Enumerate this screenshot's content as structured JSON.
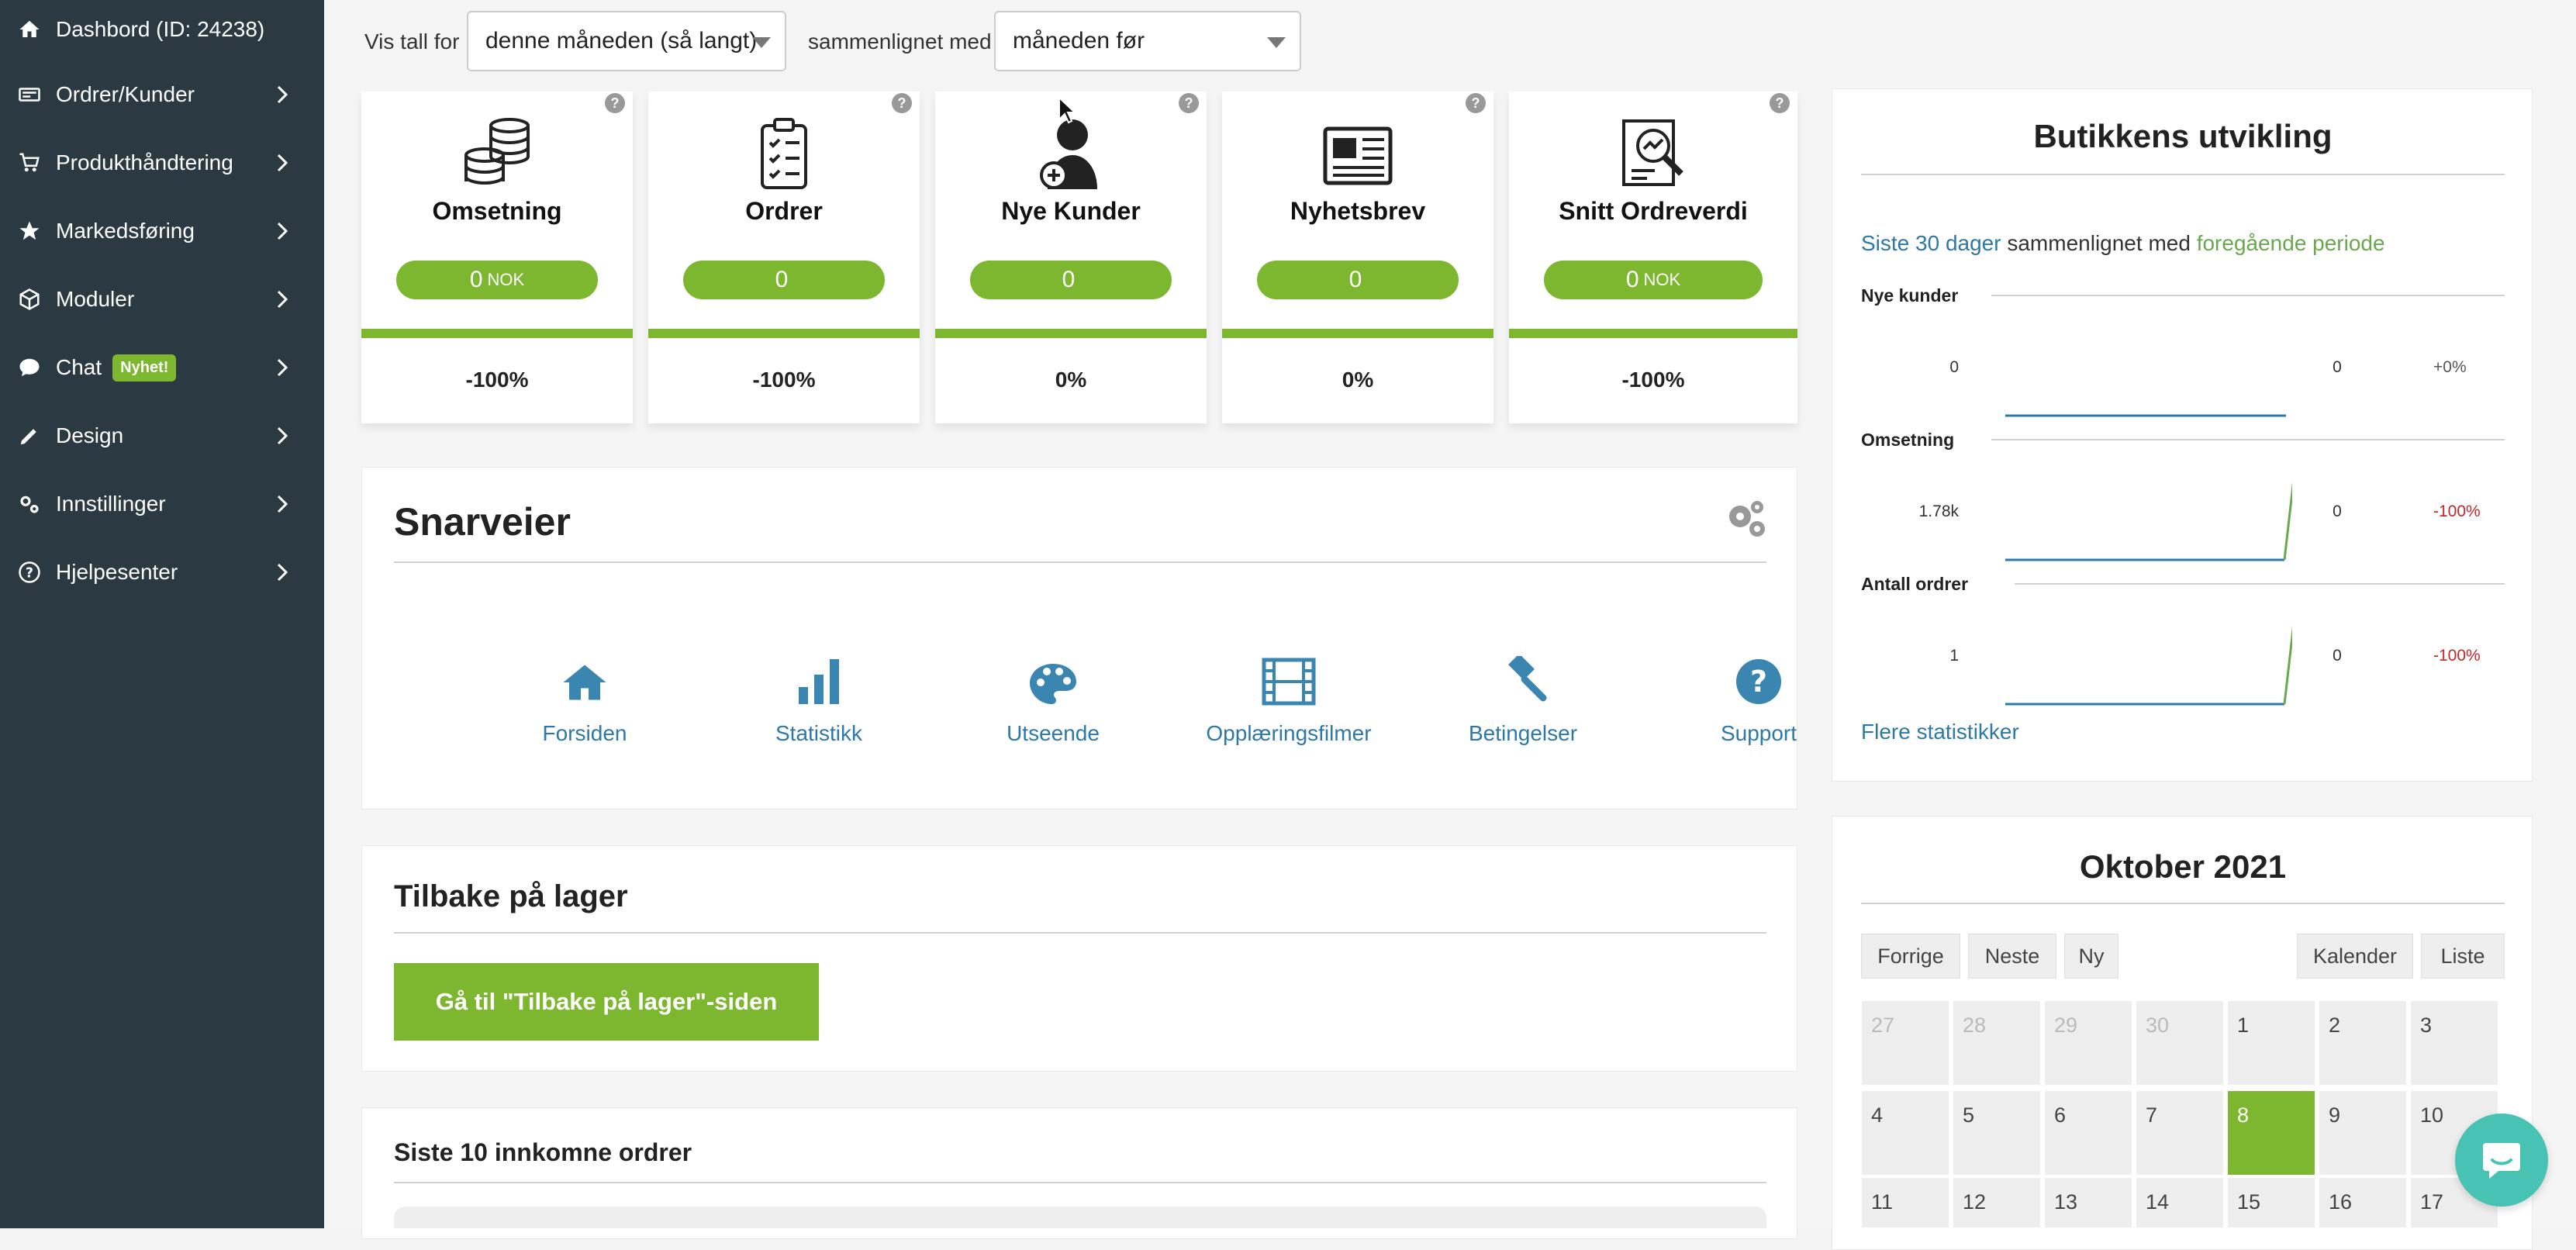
{
  "sidebar": {
    "items": [
      {
        "label": "Dashbord (ID: 24238)",
        "icon": "home-icon"
      },
      {
        "label": "Ordrer/Kunder",
        "icon": "card-icon"
      },
      {
        "label": "Produkthåndtering",
        "icon": "cart-icon"
      },
      {
        "label": "Markedsføring",
        "icon": "star-icon"
      },
      {
        "label": "Moduler",
        "icon": "cube-icon"
      },
      {
        "label": "Chat",
        "icon": "chat-icon",
        "badge": "Nyhet!"
      },
      {
        "label": "Design",
        "icon": "pencil-icon"
      },
      {
        "label": "Innstillinger",
        "icon": "gears-icon"
      },
      {
        "label": "Hjelpesenter",
        "icon": "help-circle-icon"
      }
    ]
  },
  "topbar": {
    "label1": "Vis tall for",
    "select1": "denne måneden (så langt)",
    "label2": "sammenlignet med",
    "select2": "måneden før"
  },
  "kpis": [
    {
      "title": "Omsetning",
      "value": "0",
      "unit": "NOK",
      "change": "-100%"
    },
    {
      "title": "Ordrer",
      "value": "0",
      "unit": "",
      "change": "-100%"
    },
    {
      "title": "Nye Kunder",
      "value": "0",
      "unit": "",
      "change": "0%"
    },
    {
      "title": "Nyhetsbrev",
      "value": "0",
      "unit": "",
      "change": "0%"
    },
    {
      "title": "Snitt Ordreverdi",
      "value": "0",
      "unit": "NOK",
      "change": "-100%"
    }
  ],
  "shortcuts": {
    "title": "Snarveier",
    "items": [
      {
        "label": "Forsiden"
      },
      {
        "label": "Statistikk"
      },
      {
        "label": "Utseende"
      },
      {
        "label": "Opplæringsfilmer"
      },
      {
        "label": "Betingelser"
      },
      {
        "label": "Support"
      }
    ]
  },
  "restock": {
    "title": "Tilbake på lager",
    "button": "Gå til \"Tilbake på lager\"-siden"
  },
  "orders": {
    "title": "Siste 10 innkomne ordrer"
  },
  "development": {
    "title": "Butikkens utvikling",
    "subtitle_link1": "Siste 30 dager",
    "subtitle_mid": "sammenlignet med",
    "subtitle_link2": "foregående periode",
    "rows": [
      {
        "label": "Nye kunder",
        "left": "0",
        "right": "0",
        "change": "+0%",
        "prev": 0,
        "curr": 0
      },
      {
        "label": "Omsetning",
        "left": "1.78k",
        "right": "0",
        "change": "-100%",
        "prev": 0,
        "curr": 1
      },
      {
        "label": "Antall ordrer",
        "left": "1",
        "right": "0",
        "change": "-100%",
        "prev": 0,
        "curr": 1
      }
    ],
    "more_link": "Flere statistikker"
  },
  "calendar": {
    "title": "Oktober 2021",
    "buttons": {
      "prev": "Forrige",
      "next": "Neste",
      "new": "Ny",
      "calendar": "Kalender",
      "list": "Liste"
    },
    "week1": [
      "27",
      "28",
      "29",
      "30",
      "1",
      "2",
      "3"
    ],
    "week2": [
      "4",
      "5",
      "6",
      "7",
      "8",
      "9",
      "10"
    ],
    "week3": [
      "11",
      "12",
      "13",
      "14",
      "15",
      "16",
      "17"
    ]
  },
  "colors": {
    "accent": "#7cb72f",
    "sidebar": "#2b3a42",
    "link": "#2e78a8",
    "negative": "#c0282a"
  }
}
